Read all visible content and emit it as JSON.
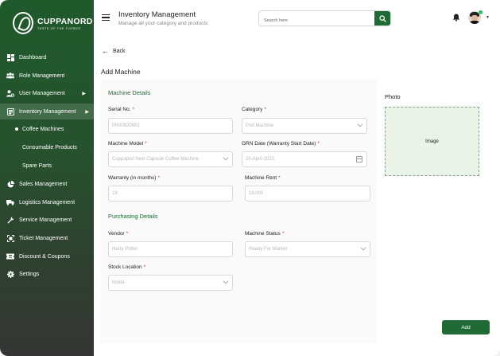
{
  "brand": {
    "name": "CUPPANORD",
    "tagline": "TASTE OF THE FJORDS"
  },
  "sidebar": {
    "items": [
      {
        "label": "Dashboard",
        "icon": "dashboard-icon"
      },
      {
        "label": "Role Management",
        "icon": "users-icon"
      },
      {
        "label": "User Management",
        "icon": "user-gear-icon"
      },
      {
        "label": "Inventory Management",
        "icon": "inventory-icon"
      },
      {
        "label": "Sales Management",
        "icon": "pie-chart-icon"
      },
      {
        "label": "Logistics Management",
        "icon": "truck-icon"
      },
      {
        "label": "Service Management",
        "icon": "wrench-icon"
      },
      {
        "label": "Ticket Management",
        "icon": "ticket-icon"
      },
      {
        "label": "Discount & Coupons",
        "icon": "coupon-icon"
      },
      {
        "label": "Settings",
        "icon": "gear-icon"
      }
    ],
    "subitems": [
      "Coffee Machines",
      "Consumable Products",
      "Spare Parts"
    ]
  },
  "header": {
    "title": "Inventory Management",
    "subtitle": "Manage all your category and products",
    "search_placeholder": "Search here"
  },
  "page": {
    "back_label": "Back",
    "title": "Add Machine",
    "add_label": "Add"
  },
  "machine_details": {
    "title": "Machine Details",
    "serial_label": "Serial No.",
    "serial_value": "PK00920002",
    "category_label": "Category",
    "category_value": "Pod Machine",
    "model_label": "Machine Model",
    "model_value": "Cuppapod Next Capsule Coffee Machine",
    "grn_label": "GRN Date (Warranty Start Date)",
    "grn_value": "20-April-2023",
    "warranty_label": "Warranty (in months)",
    "warranty_value": "19",
    "rent_label": "Machine Rent",
    "rent_value": "19,000"
  },
  "purchasing_details": {
    "title": "Purchasing Details",
    "vendor_label": "Vendor",
    "vendor_value": "Harry Potter",
    "status_label": "Machine Status",
    "status_value": "Ready For Market",
    "location_label": "Stock Location",
    "location_value": "Noida"
  },
  "photo": {
    "label": "Photo",
    "placeholder": "Image"
  },
  "required_mark": "*"
}
